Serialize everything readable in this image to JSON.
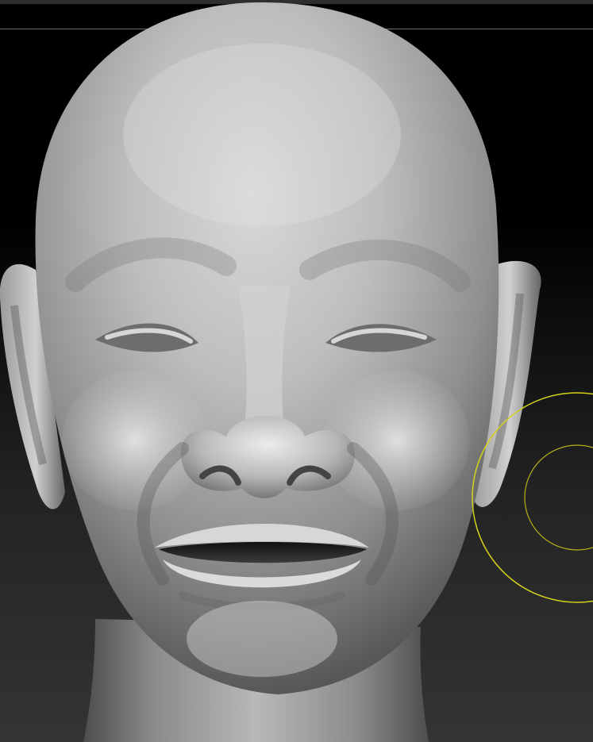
{
  "canvas": {
    "background_color": "#000000",
    "floor_color": "#343434"
  },
  "model": {
    "subject": "sculpted-head-icon",
    "material_color": "#b9b9b9",
    "highlight_color": "#e2e2e2",
    "shadow_color": "#4a4a4a"
  },
  "brush": {
    "outer_ring_icon": "brush-outer-ring-icon",
    "inner_ring_icon": "brush-inner-ring-icon",
    "color": "#d6d21c"
  }
}
